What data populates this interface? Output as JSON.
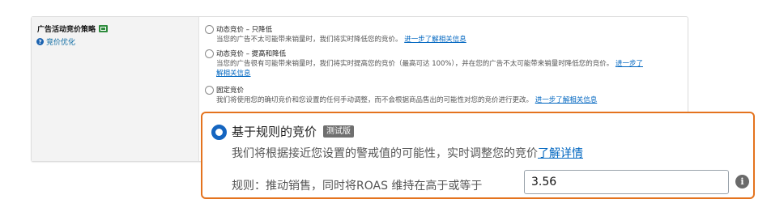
{
  "strategy": {
    "title": "广告活动竞价策略",
    "new_badge_icon": "new-icon",
    "help_link": "竞价优化"
  },
  "options": [
    {
      "title": "动态竞价 – 只降低",
      "desc": "当您的广告不太可能带来销量时，我们将实时降低您的竞价。",
      "link": "进一步了解相关信息"
    },
    {
      "title": "动态竞价 – 提高和降低",
      "desc_line1": "当您的广告很有可能带来销量时，我们将实时提高您的竞价（最高可达 100%），并在您的广告不太可能带来销量时降低您的竞价。",
      "link_part1": "进一步了",
      "link_part2": "解相关信息"
    },
    {
      "title": "固定竞价",
      "desc": "我们将使用您的确切竞价和您设置的任何手动调整，而不会根据商品售出的可能性对您的竞价进行更改。",
      "link": "进一步了解相关信息"
    }
  ],
  "rule_based": {
    "title": "基于规则的竞价",
    "badge": "测试版",
    "desc": "我们将根据接近您设置的警戒值的可能性，实时调整您的竞价",
    "link": "了解详情",
    "rule_label": "规则：推动销售，同时将ROAS 维持在高于或等于",
    "roas_value": "3.56",
    "info_icon": "info-icon",
    "accent_color": "#e4731e",
    "selected_color": "#1565c0"
  }
}
